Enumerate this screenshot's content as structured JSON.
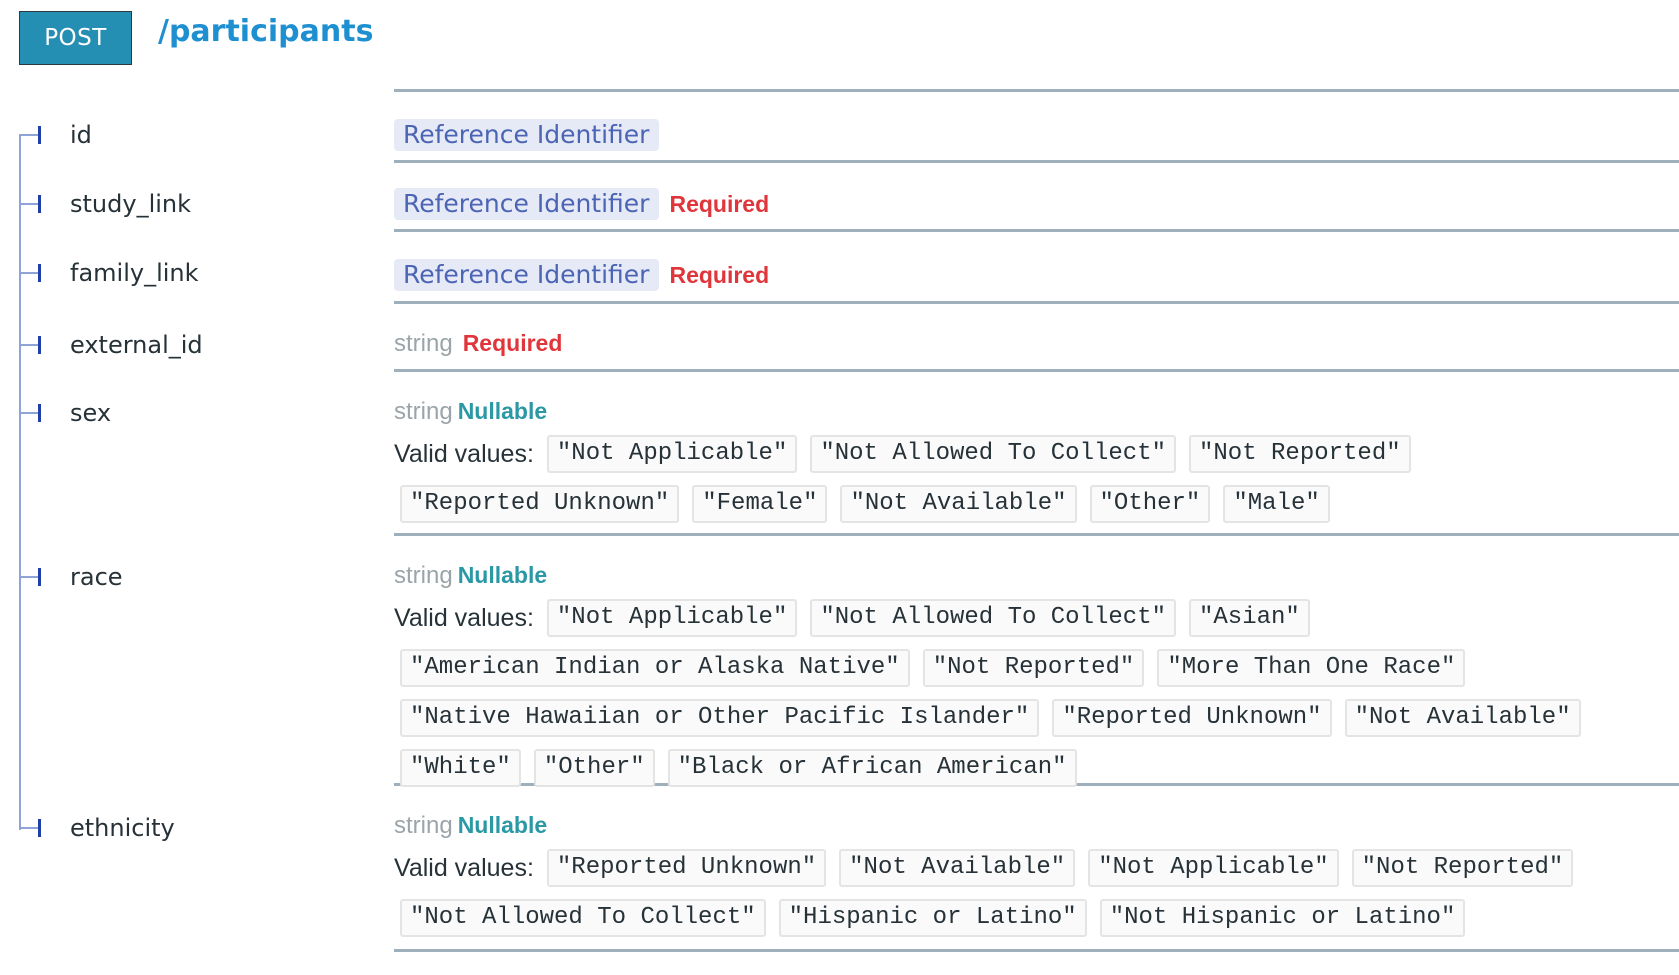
{
  "header": {
    "method": "POST",
    "path": "/participants"
  },
  "colors": {
    "method_bg": "#258eb3",
    "path": "#1e8fd0",
    "required": "#e0353a",
    "nullable": "#2b98a6",
    "reference_bg": "#e6eaf7",
    "reference_text": "#4b64b3"
  },
  "fields": [
    {
      "name": "id",
      "type": "Reference Identifier",
      "type_style": "reference",
      "flag": ""
    },
    {
      "name": "study_link",
      "type": "Reference Identifier",
      "type_style": "reference",
      "flag": "Required"
    },
    {
      "name": "family_link",
      "type": "Reference Identifier",
      "type_style": "reference",
      "flag": "Required"
    },
    {
      "name": "external_id",
      "type": "string",
      "type_style": "plain",
      "flag": "Required"
    },
    {
      "name": "sex",
      "type": "string",
      "type_style": "plain",
      "flag": "Nullable",
      "valid_values_label": "Valid values:",
      "valid_values": [
        "\"Not Applicable\"",
        "\"Not Allowed To Collect\"",
        "\"Not Reported\"",
        "\"Reported Unknown\"",
        "\"Female\"",
        "\"Not Available\"",
        "\"Other\"",
        "\"Male\""
      ]
    },
    {
      "name": "race",
      "type": "string",
      "type_style": "plain",
      "flag": "Nullable",
      "valid_values_label": "Valid values:",
      "valid_values": [
        "\"Not Applicable\"",
        "\"Not Allowed To Collect\"",
        "\"Asian\"",
        "\"American Indian or Alaska Native\"",
        "\"Not Reported\"",
        "\"More Than One Race\"",
        "\"Native Hawaiian or Other Pacific Islander\"",
        "\"Reported Unknown\"",
        "\"Not Available\"",
        "\"White\"",
        "\"Other\"",
        "\"Black or African American\""
      ]
    },
    {
      "name": "ethnicity",
      "type": "string",
      "type_style": "plain",
      "flag": "Nullable",
      "valid_values_label": "Valid values:",
      "valid_values": [
        "\"Reported Unknown\"",
        "\"Not Available\"",
        "\"Not Applicable\"",
        "\"Not Reported\"",
        "\"Not Allowed To Collect\"",
        "\"Hispanic or Latino\"",
        "\"Not Hispanic or Latino\""
      ]
    }
  ]
}
